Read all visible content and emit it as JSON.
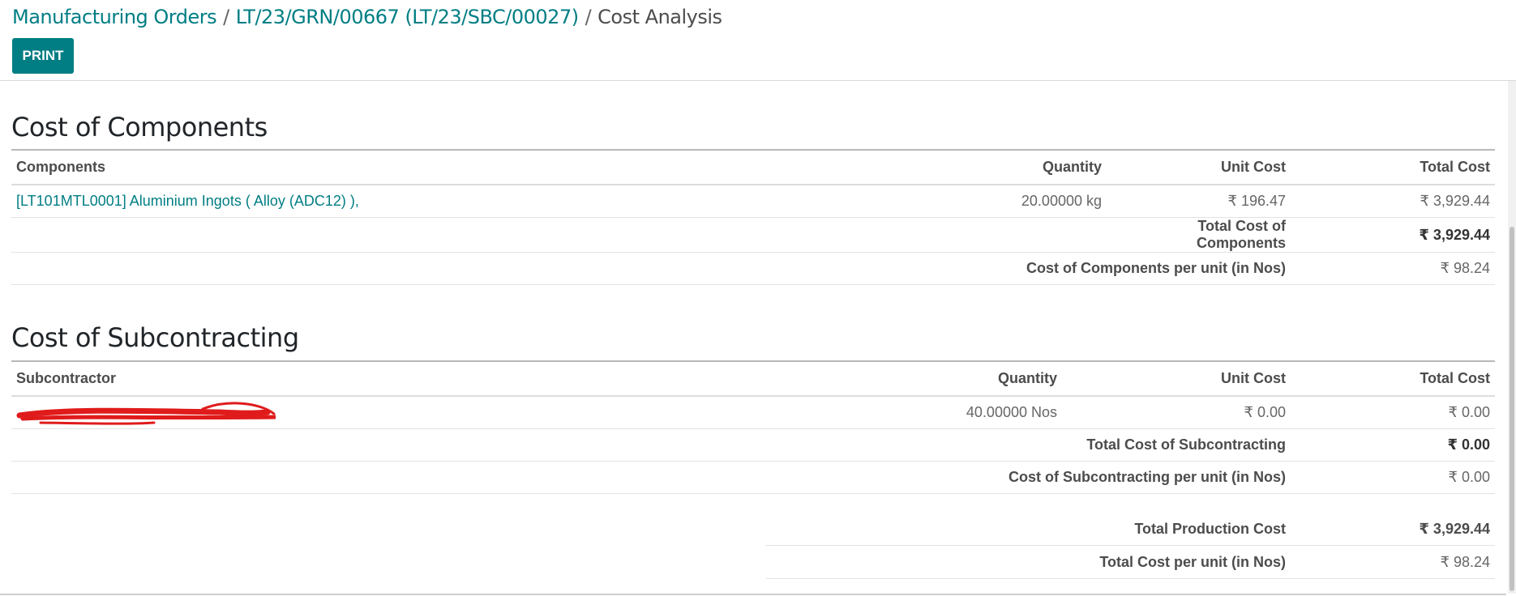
{
  "breadcrumb": {
    "root": "Manufacturing Orders",
    "record": "LT/23/GRN/00667 (LT/23/SBC/00027)",
    "current": "Cost Analysis",
    "separator": "/"
  },
  "toolbar": {
    "print_label": "PRINT"
  },
  "colors": {
    "accent": "#017e84",
    "redaction": "#e01b1b"
  },
  "components": {
    "title": "Cost of Components",
    "headers": {
      "name": "Components",
      "quantity": "Quantity",
      "unit_cost": "Unit Cost",
      "total_cost": "Total Cost"
    },
    "rows": [
      {
        "name": "[LT101MTL0001] Aluminium Ingots ( Alloy (ADC12) ),",
        "quantity": "20.00000 kg",
        "unit_cost": "₹ 196.47",
        "total_cost": "₹ 3,929.44"
      }
    ],
    "total_label": "Total Cost of Components",
    "total_value": "₹ 3,929.44",
    "per_unit_label": "Cost of Components per unit (in Nos)",
    "per_unit_value": "₹ 98.24"
  },
  "subcontracting": {
    "title": "Cost of Subcontracting",
    "headers": {
      "name": "Subcontractor",
      "quantity": "Quantity",
      "unit_cost": "Unit Cost",
      "total_cost": "Total Cost"
    },
    "rows": [
      {
        "quantity": "40.00000 Nos",
        "unit_cost": "₹ 0.00",
        "total_cost": "₹ 0.00"
      }
    ],
    "total_label": "Total Cost of Subcontracting",
    "total_value": "₹ 0.00",
    "per_unit_label": "Cost of Subcontracting per unit (in Nos)",
    "per_unit_value": "₹ 0.00"
  },
  "summary": {
    "total_label": "Total Production Cost",
    "total_value": "₹ 3,929.44",
    "per_unit_label": "Total Cost per unit (in Nos)",
    "per_unit_value": "₹ 98.24"
  }
}
